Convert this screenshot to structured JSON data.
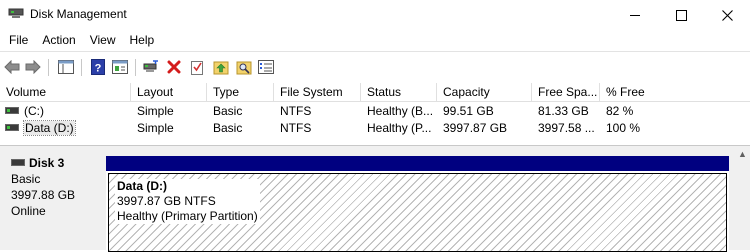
{
  "window": {
    "title": "Disk Management"
  },
  "menu": [
    "File",
    "Action",
    "View",
    "Help"
  ],
  "toolbar": {
    "icons": [
      "back-icon",
      "forward-icon",
      "console-tree-icon",
      "help-icon",
      "properties-icon",
      "connect-icon",
      "delete-icon",
      "check-icon",
      "up-arrow-folder-icon",
      "search-folder-icon",
      "list-icon"
    ]
  },
  "volume_table": {
    "columns": [
      "Volume",
      "Layout",
      "Type",
      "File System",
      "Status",
      "Capacity",
      "Free Spa...",
      "% Free"
    ],
    "rows": [
      [
        "(C:)",
        "Simple",
        "Basic",
        "NTFS",
        "Healthy (B...",
        "99.51 GB",
        "81.33 GB",
        "82 %"
      ],
      [
        "Data (D:)",
        "Simple",
        "Basic",
        "NTFS",
        "Healthy (P...",
        "3997.87 GB",
        "3997.58 ...",
        "100 %"
      ]
    ],
    "selected_row": 1
  },
  "disk": {
    "name": "Disk 3",
    "type": "Basic",
    "size": "3997.88 GB",
    "status": "Online"
  },
  "partition": {
    "name": "Data  (D:)",
    "size_fs": "3997.87 GB NTFS",
    "status": "Healthy (Primary Partition)"
  },
  "colors": {
    "partition_bar": "#000080"
  }
}
